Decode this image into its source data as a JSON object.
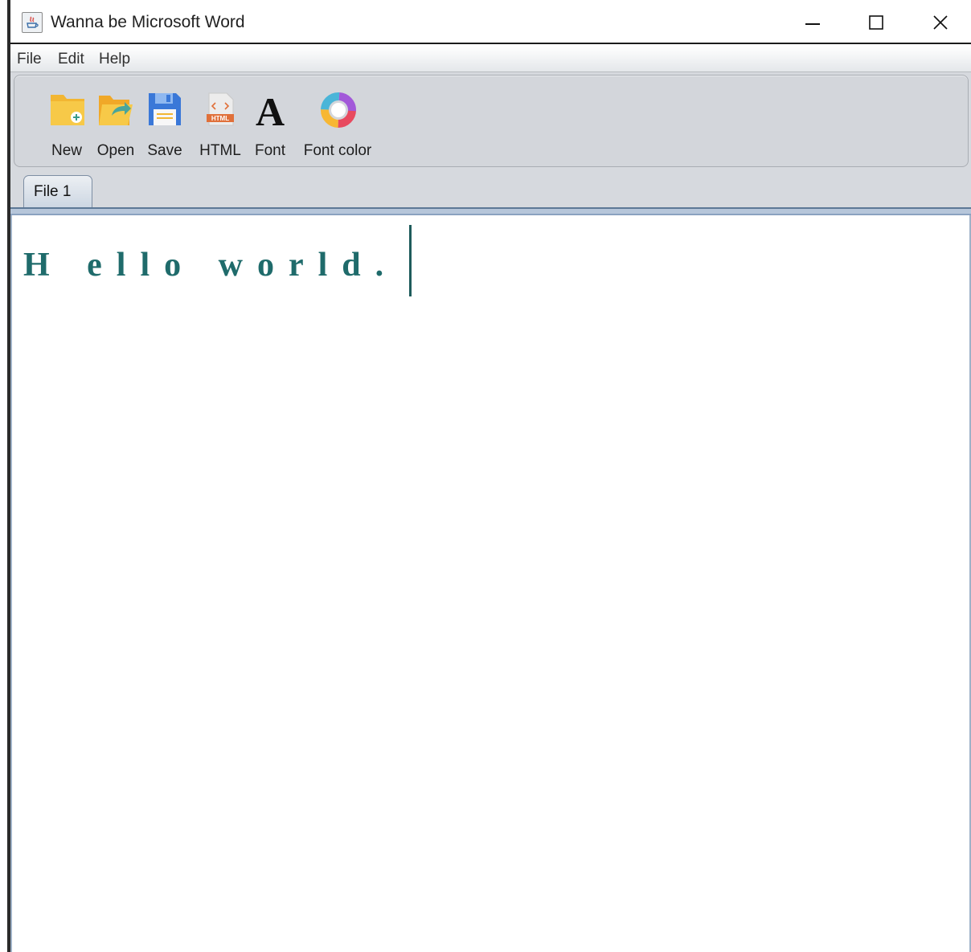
{
  "window": {
    "title": "Wanna be Microsoft Word"
  },
  "menu": {
    "items": [
      "File",
      "Edit",
      "Help"
    ]
  },
  "toolbar": {
    "buttons": [
      {
        "label": "New",
        "icon": "new-file-icon"
      },
      {
        "label": "Open",
        "icon": "open-folder-icon"
      },
      {
        "label": "Save",
        "icon": "save-floppy-icon"
      },
      {
        "label": "HTML",
        "icon": "html-file-icon"
      },
      {
        "label": "Font",
        "icon": "font-letter-icon"
      },
      {
        "label": "Font color",
        "icon": "color-wheel-icon"
      }
    ]
  },
  "tabs": [
    {
      "label": "File 1",
      "active": true
    }
  ],
  "editor": {
    "text": "H ello world.",
    "text_color": "#1f6b6b"
  },
  "colors": {
    "toolbar_bg": "#d3d6db",
    "tab_accent": "#8aa2c0",
    "window_bg": "#ffffff"
  }
}
